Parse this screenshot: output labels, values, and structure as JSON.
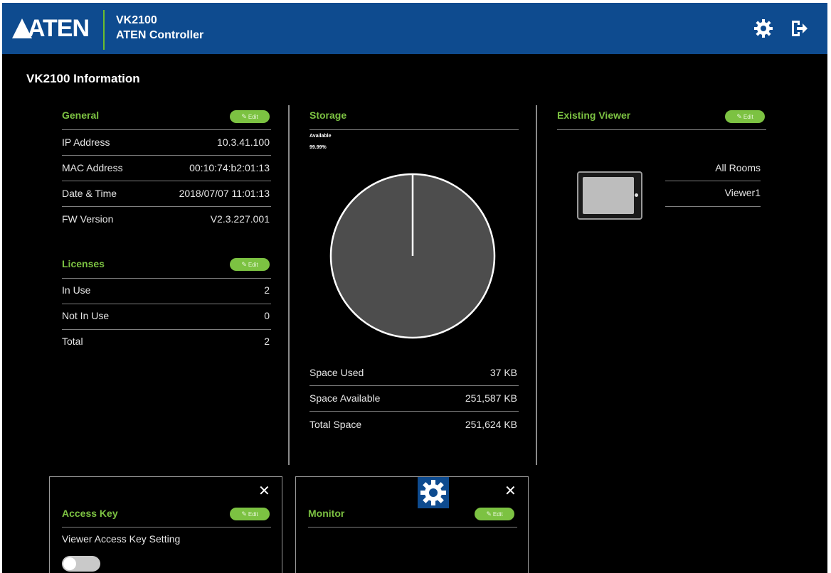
{
  "header": {
    "logo_text": "ATEN",
    "model": "VK2100",
    "product": "ATEN Controller",
    "icons": [
      "gear-icon",
      "logout-icon"
    ],
    "brand_color": "#0e4b8f",
    "accent_color": "#7cc242"
  },
  "page_title": "VK2100 Information",
  "general": {
    "title": "General",
    "edit_label": "Edit",
    "rows": [
      {
        "label": "IP Address",
        "value": "10.3.41.100"
      },
      {
        "label": "MAC Address",
        "value": "00:10:74:b2:01:13"
      },
      {
        "label": "Date & Time",
        "value": "2018/07/07 11:01:13"
      },
      {
        "label": "FW Version",
        "value": "V2.3.227.001"
      }
    ]
  },
  "licenses": {
    "title": "Licenses",
    "edit_label": "Edit",
    "rows": [
      {
        "label": "In Use",
        "value": "2"
      },
      {
        "label": "Not In Use",
        "value": "0"
      },
      {
        "label": "Total",
        "value": "2"
      }
    ]
  },
  "storage": {
    "title": "Storage",
    "legend_label": "Available",
    "legend_value": "99.99%",
    "rows": [
      {
        "label": "Space Used",
        "value": "37 KB"
      },
      {
        "label": "Space Available",
        "value": "251,587 KB"
      },
      {
        "label": "Total Space",
        "value": "251,624 KB"
      }
    ]
  },
  "chart_data": {
    "type": "pie",
    "slices": [
      {
        "name": "Available",
        "value": 251587
      },
      {
        "value": 37
      }
    ],
    "colors": [
      "#4d4d4d",
      "#ffffff"
    ]
  },
  "existing_viewer": {
    "title": "Existing Viewer",
    "edit_label": "Edit",
    "items": [
      "All Rooms",
      "Viewer1"
    ]
  },
  "access_key": {
    "title": "Access Key",
    "edit_label": "Edit",
    "setting_label": "Viewer Access Key Setting",
    "toggle_on": false
  },
  "monitor": {
    "title": "Monitor",
    "edit_label": "Edit"
  }
}
